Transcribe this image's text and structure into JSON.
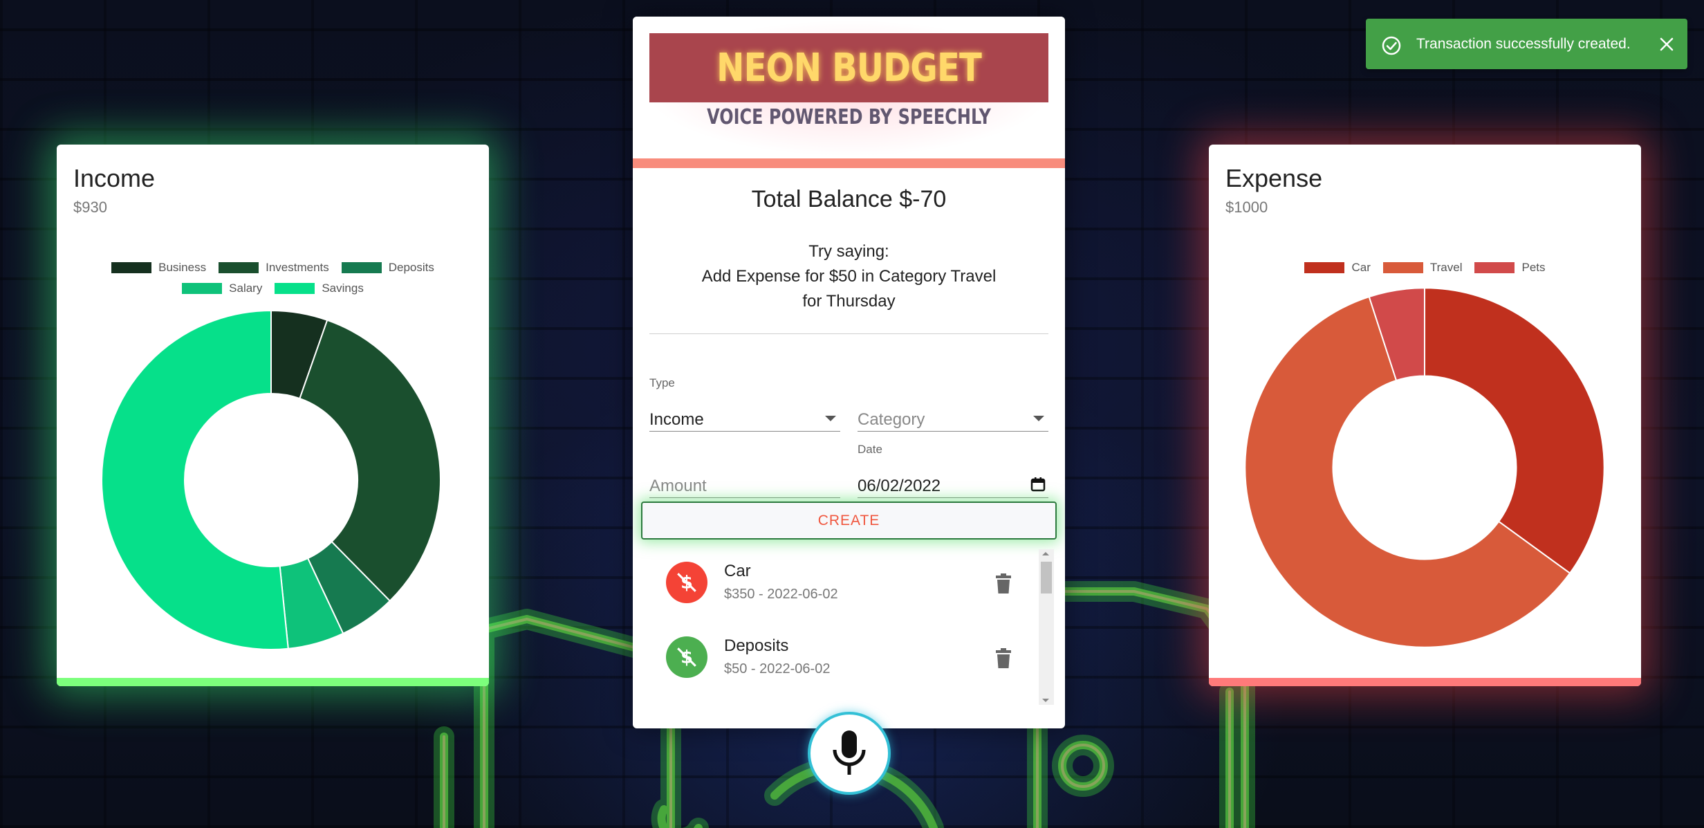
{
  "income": {
    "title": "Income",
    "total": "$930",
    "legend": [
      "Business",
      "Investments",
      "Deposits",
      "Salary",
      "Savings"
    ],
    "chart_data": {
      "type": "pie",
      "title": "",
      "labels": [
        "Business",
        "Investments",
        "Deposits",
        "Salary",
        "Savings"
      ],
      "values": [
        50,
        300,
        50,
        50,
        480
      ],
      "colors": [
        "#15301f",
        "#1a4f2e",
        "#167a50",
        "#0ec27a",
        "#06e08a"
      ]
    }
  },
  "expense": {
    "title": "Expense",
    "total": "$1000",
    "legend": [
      "Car",
      "Travel",
      "Pets"
    ],
    "chart_data": {
      "type": "pie",
      "title": "",
      "labels": [
        "Car",
        "Travel",
        "Pets"
      ],
      "values": [
        350,
        600,
        50
      ],
      "colors": [
        "#c0301e",
        "#d85a3a",
        "#d14a4a"
      ]
    }
  },
  "header": {
    "logo": "NEON BUDGET",
    "tagline": "VOICE POWERED BY SPEECHLY"
  },
  "main": {
    "total_balance": "Total Balance $-70",
    "hint_line1": "Try saying:",
    "hint_line2": "Add Expense for $50 in Category Travel",
    "hint_line3": "for Thursday"
  },
  "form": {
    "type_label": "Type",
    "type_value": "Income",
    "category_placeholder": "Category",
    "amount_placeholder": "Amount",
    "date_label": "Date",
    "date_value": "06/02/2022",
    "create_label": "CREATE"
  },
  "transactions": [
    {
      "name": "Car",
      "detail": "$350 - 2022-06-02",
      "kind": "expense",
      "color": "#f44336",
      "icon": "money-off-icon"
    },
    {
      "name": "Deposits",
      "detail": "$50 - 2022-06-02",
      "kind": "income",
      "color": "#4caf50",
      "icon": "dollar-icon"
    }
  ],
  "toast": {
    "message": "Transaction successfully created.",
    "color": "#43a047"
  },
  "colors": {
    "income_glow": "#7cff7c",
    "expense_glow": "#ff7a7a",
    "accent": "#f88c7c",
    "mic_ring": "#33c0d6"
  }
}
